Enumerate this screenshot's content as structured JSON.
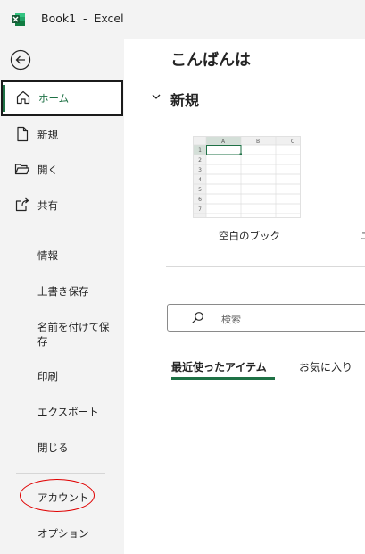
{
  "window": {
    "title": "Book1  -  Excel",
    "icon": "excel-icon",
    "brand_color": "#1e7145"
  },
  "sidebar": {
    "back_icon": "back-arrow-icon",
    "primary": [
      {
        "label": "ホーム",
        "icon": "home-icon",
        "active": true
      },
      {
        "label": "新規",
        "icon": "new-document-icon"
      },
      {
        "label": "開く",
        "icon": "folder-open-icon"
      },
      {
        "label": "共有",
        "icon": "share-icon"
      }
    ],
    "secondary": [
      "情報",
      "上書き保存",
      "名前を付けて保存",
      "印刷",
      "エクスポート",
      "閉じる"
    ],
    "footer": [
      "アカウント",
      "オプション"
    ],
    "highlight_color": "#e00000"
  },
  "main": {
    "greeting": "こんばんは",
    "new_section": {
      "heading": "新規",
      "template_caption": "空白のブック",
      "next_template_fragment": "ユ",
      "thumbnail_columns": [
        "A",
        "B",
        "C"
      ],
      "thumbnail_rows": [
        "1",
        "2",
        "3",
        "4",
        "5",
        "6",
        "7"
      ]
    },
    "search": {
      "placeholder": "検索",
      "icon": "search-icon"
    },
    "tabs": [
      {
        "label": "最近使ったアイテム",
        "active": true
      },
      {
        "label": "お気に入り"
      }
    ]
  }
}
